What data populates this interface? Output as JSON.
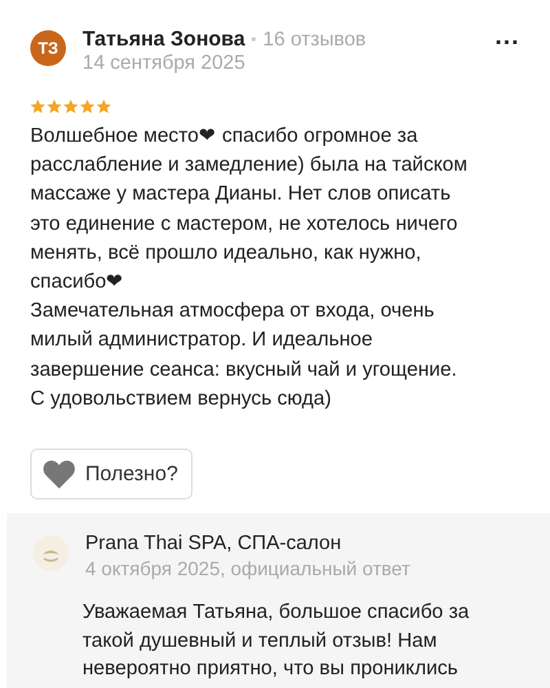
{
  "review": {
    "author": {
      "initials": "ТЗ",
      "name": "Татьяна Зонова",
      "reviews_count": "16 отзывов",
      "date": "14 сентября 2025"
    },
    "menu": "...",
    "stars": 5,
    "paragraphs": [
      "Волшебное место❤ спасибо огромное за расслабление и замедление) была на тайском массаже у мастера Дианы. Нет слов описать это единение с мастером, не хотелось ничего менять, всё прошло идеально, как нужно, спасибо❤",
      "Замечательная атмосфера от входа, очень милый администратор. И идеальное завершение сеанса: вкусный чай и угощение. С удовольствием вернусь сюда)"
    ],
    "helpful_button": {
      "label": "Полезно?"
    }
  },
  "reply": {
    "name": "Prana Thai SPA, СПА-салон",
    "date": "4 октября 2025, официальный ответ",
    "text": "Уважаемая Татьяна, большое спасибо за такой душевный и теплый отзыв! Нам невероятно приятно, что вы прониклись"
  }
}
